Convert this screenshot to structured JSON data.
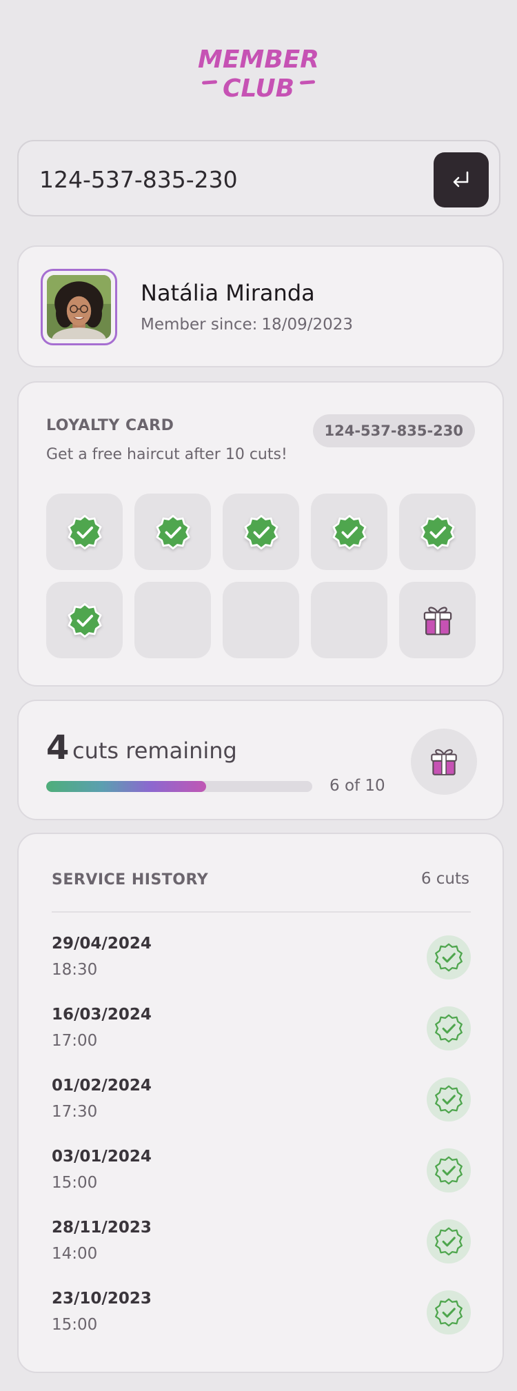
{
  "app": {
    "logo_line1": "MEMBER",
    "logo_line2": "CLUB",
    "accent_color": "#c652b4"
  },
  "search": {
    "value": "124-537-835-230",
    "placeholder": "124-537-835-230",
    "submit_icon": "enter-icon"
  },
  "profile": {
    "name": "Natália Miranda",
    "member_since_label": "Member since:",
    "member_since_date": "18/09/2023"
  },
  "loyalty": {
    "title": "LOYALTY CARD",
    "description": "Get a free haircut after 10 cuts!",
    "card_id": "124-537-835-230",
    "total": 10,
    "completed": 6,
    "stamp_icon": "check-badge-icon",
    "reward_icon": "gift-icon"
  },
  "remaining": {
    "count": "4",
    "label": "cuts remaining",
    "progress_text": "6 of 10",
    "progress_fraction": 0.6
  },
  "history": {
    "title": "SERVICE HISTORY",
    "count": "6 cuts",
    "items": [
      {
        "date": "29/04/2024",
        "time": "18:30"
      },
      {
        "date": "16/03/2024",
        "time": "17:00"
      },
      {
        "date": "01/02/2024",
        "time": "17:30"
      },
      {
        "date": "03/01/2024",
        "time": "15:00"
      },
      {
        "date": "28/11/2023",
        "time": "14:00"
      },
      {
        "date": "23/10/2023",
        "time": "15:00"
      }
    ]
  }
}
